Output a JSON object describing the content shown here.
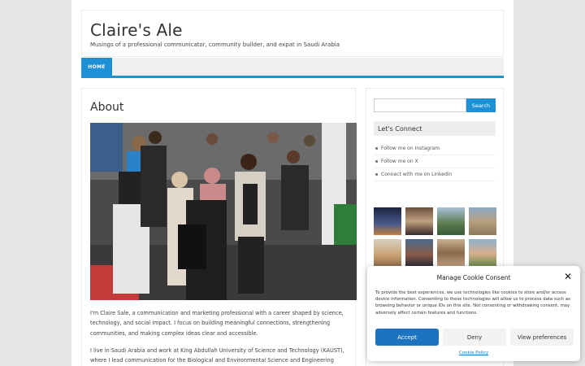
{
  "site": {
    "title": "Claire's Ale",
    "tagline": "Musings of a professional communicator, community builder, and expat in Saudi Arabia"
  },
  "nav": {
    "home_label": "HOME"
  },
  "page": {
    "title": "About",
    "paragraph1": "I'm Claire Sale, a communication and marketing professional with a career shaped by science, technology, and social impact. I focus on building meaningful connections, strengthening communities, and making complex ideas clear and accessible.",
    "paragraph2": "I live in Saudi Arabia and work at King Abdullah University of Science and Technology (KAUST), where I lead communication for the Biological and Environmental Science and Engineering Division. Over the"
  },
  "sidebar": {
    "search_placeholder": "",
    "search_button": "Search",
    "connect_title": "Let's Connect",
    "links": [
      "Follow me on Instagram",
      "Follow me on X",
      "Connect with me on Linkedin"
    ]
  },
  "cookie": {
    "title": "Manage Cookie Consent",
    "text": "To provide the best experiences, we use technologies like cookies to store and/or access device information. Consenting to these technologies will allow us to process data such as browsing behavior or unique IDs on this site. Not consenting or withdrawing consent, may adversely affect certain features and functions.",
    "accept": "Accept",
    "deny": "Deny",
    "preferences": "View preferences",
    "policy": "Cookie Policy"
  },
  "colors": {
    "accent": "#1e90d6",
    "button_blue": "#1e73be"
  },
  "icons": {
    "close": "close-icon"
  }
}
